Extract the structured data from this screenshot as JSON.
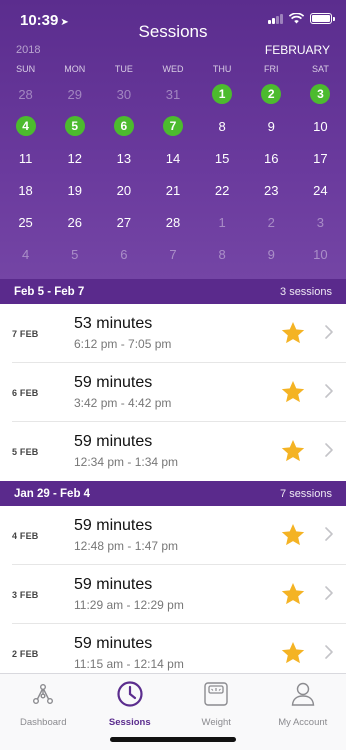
{
  "status": {
    "time": "10:39"
  },
  "header": {
    "title": "Sessions",
    "year": "2018",
    "month": "FEBRUARY"
  },
  "calendar": {
    "weekdays": [
      "SUN",
      "MON",
      "TUE",
      "WED",
      "THU",
      "FRI",
      "SAT"
    ],
    "weeks": [
      [
        {
          "d": "28",
          "dim": true
        },
        {
          "d": "29",
          "dim": true
        },
        {
          "d": "30",
          "dim": true
        },
        {
          "d": "31",
          "dim": true
        },
        {
          "d": "1",
          "session": true
        },
        {
          "d": "2",
          "session": true
        },
        {
          "d": "3",
          "session": true
        }
      ],
      [
        {
          "d": "4",
          "session": true
        },
        {
          "d": "5",
          "session": true
        },
        {
          "d": "6",
          "session": true
        },
        {
          "d": "7",
          "session": true
        },
        {
          "d": "8"
        },
        {
          "d": "9"
        },
        {
          "d": "10"
        }
      ],
      [
        {
          "d": "11"
        },
        {
          "d": "12"
        },
        {
          "d": "13"
        },
        {
          "d": "14"
        },
        {
          "d": "15"
        },
        {
          "d": "16"
        },
        {
          "d": "17"
        }
      ],
      [
        {
          "d": "18"
        },
        {
          "d": "19"
        },
        {
          "d": "20"
        },
        {
          "d": "21"
        },
        {
          "d": "22"
        },
        {
          "d": "23"
        },
        {
          "d": "24"
        }
      ],
      [
        {
          "d": "25"
        },
        {
          "d": "26"
        },
        {
          "d": "27"
        },
        {
          "d": "28"
        },
        {
          "d": "1",
          "dim": true
        },
        {
          "d": "2",
          "dim": true
        },
        {
          "d": "3",
          "dim": true
        }
      ],
      [
        {
          "d": "4",
          "dim": true
        },
        {
          "d": "5",
          "dim": true
        },
        {
          "d": "6",
          "dim": true
        },
        {
          "d": "7",
          "dim": true
        },
        {
          "d": "8",
          "dim": true
        },
        {
          "d": "9",
          "dim": true
        },
        {
          "d": "10",
          "dim": true
        }
      ]
    ]
  },
  "groups": [
    {
      "range": "Feb 5 - Feb 7",
      "count": "3 sessions",
      "sessions": [
        {
          "date": "7 FEB",
          "duration": "53 minutes",
          "time": "6:12 pm - 7:05 pm"
        },
        {
          "date": "6 FEB",
          "duration": "59 minutes",
          "time": "3:42 pm - 4:42 pm"
        },
        {
          "date": "5 FEB",
          "duration": "59 minutes",
          "time": "12:34 pm - 1:34 pm"
        }
      ]
    },
    {
      "range": "Jan 29 - Feb 4",
      "count": "7 sessions",
      "sessions": [
        {
          "date": "4 FEB",
          "duration": "59 minutes",
          "time": "12:48 pm - 1:47 pm"
        },
        {
          "date": "3 FEB",
          "duration": "59 minutes",
          "time": "11:29 am - 12:29 pm"
        },
        {
          "date": "2 FEB",
          "duration": "59 minutes",
          "time": "11:15 am - 12:14 pm"
        }
      ]
    }
  ],
  "tabs": [
    {
      "label": "Dashboard",
      "icon": "dashboard-icon",
      "active": false
    },
    {
      "label": "Sessions",
      "icon": "clock-icon",
      "active": true
    },
    {
      "label": "Weight",
      "icon": "scale-icon",
      "active": false
    },
    {
      "label": "My Account",
      "icon": "person-icon",
      "active": false
    }
  ],
  "colors": {
    "header": "#5b2d8e",
    "session_dot": "#4cbb2e",
    "star": "#f4b324",
    "active_tab": "#5b2d8e"
  }
}
